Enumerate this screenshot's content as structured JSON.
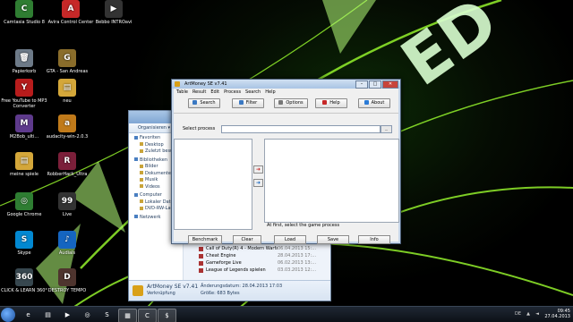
{
  "desktop_icons": [
    {
      "label": "Camtasia Studio 8",
      "glyph": "C",
      "color": "#2f7d32"
    },
    {
      "label": "Avira Control Center",
      "glyph": "A",
      "color": "#c62828"
    },
    {
      "label": "Bebbo INTROavi",
      "glyph": "▶",
      "color": "#333333"
    },
    {
      "label": "Papierkorb",
      "glyph": "🗑",
      "color": "#6d7a88"
    },
    {
      "label": "GTA - San Andreas",
      "glyph": "G",
      "color": "#8a6d2b"
    },
    {
      "label": "Free YouTube to MP3 Converter",
      "glyph": "Y",
      "color": "#b71c1c"
    },
    {
      "label": "neu",
      "glyph": "▤",
      "color": "#d4a73a"
    },
    {
      "label": "M2Bob_ulti...",
      "glyph": "M",
      "color": "#5e3a8c"
    },
    {
      "label": "audacity-win-2.0.3",
      "glyph": "a",
      "color": "#c07a1a"
    },
    {
      "label": "meine spiele",
      "glyph": "▤",
      "color": "#d4a73a"
    },
    {
      "label": "RobberHack_Ultra",
      "glyph": "R",
      "color": "#7b1f3a"
    },
    {
      "label": "Google Chrome",
      "glyph": "◎",
      "color": "#2e7d32"
    },
    {
      "label": "Live",
      "glyph": "99",
      "color": "#333333"
    },
    {
      "label": "Skype",
      "glyph": "S",
      "color": "#0288d1"
    },
    {
      "label": "Audials",
      "glyph": "♪",
      "color": "#1565c0"
    },
    {
      "label": "CLICK & LEARN 360°",
      "glyph": "360",
      "color": "#37474f"
    },
    {
      "label": "DESTROY TEMPO",
      "glyph": "D",
      "color": "#4e342e"
    }
  ],
  "explorer": {
    "toolbar_label": "Organisieren ▾",
    "nav": [
      {
        "label": "Favoriten",
        "head": true
      },
      {
        "label": "Desktop",
        "head": false
      },
      {
        "label": "Zuletzt besucht",
        "head": false
      },
      {
        "label": "Bibliotheken",
        "head": true
      },
      {
        "label": "Bilder",
        "head": false
      },
      {
        "label": "Dokumente",
        "head": false
      },
      {
        "label": "Musik",
        "head": false
      },
      {
        "label": "Videos",
        "head": false
      },
      {
        "label": "Computer",
        "head": true
      },
      {
        "label": "Lokaler Datenträger",
        "head": false
      },
      {
        "label": "DVD-RW-Laufwerk",
        "head": false
      },
      {
        "label": "Netzwerk",
        "head": true
      }
    ],
    "files": [
      {
        "name": "Call of Duty(R) 4 - Modern Warfare(TM) - Singleplayer",
        "date": "06.04.2013 15:..."
      },
      {
        "name": "Cheat Engine",
        "date": "28.04.2013 17:..."
      },
      {
        "name": "Gameforge Live",
        "date": "06.02.2013 13:..."
      },
      {
        "name": "League of Legends spielen",
        "date": "03.03.2013 12:..."
      }
    ],
    "details": {
      "name": "ArtMoney SE v7.41",
      "type": "Verknüpfung",
      "date_label": "Änderungsdatum: 28.04.2013 17:03",
      "size_label": "Größe: 683 Bytes"
    }
  },
  "artmoney": {
    "title": "ArtMoney SE v7.41",
    "menu": [
      "Table",
      "Result",
      "Edit",
      "Process",
      "Search",
      "Help"
    ],
    "buttons": {
      "search": "Search",
      "filter": "Filter",
      "options": "Options",
      "help": "Help",
      "about": "About"
    },
    "select_process_label": "Select process",
    "select_process_value": "",
    "status": "At first, select the game process",
    "bottom_buttons": {
      "benchmark": "Benchmark",
      "clear": "Clear",
      "load": "Load",
      "save": "Save",
      "info": "Info"
    }
  },
  "taskbar": {
    "items": [
      {
        "glyph": "e",
        "name": "internet-explorer-icon"
      },
      {
        "glyph": "▤",
        "name": "explorer-icon"
      },
      {
        "glyph": "▶",
        "name": "media-player-icon"
      },
      {
        "glyph": "◎",
        "name": "chrome-icon"
      },
      {
        "glyph": "S",
        "name": "skype-icon"
      },
      {
        "glyph": "▦",
        "name": "game-icon"
      },
      {
        "glyph": "C",
        "name": "camtasia-icon"
      },
      {
        "glyph": "$",
        "name": "artmoney-icon"
      }
    ],
    "language": "DE",
    "time": "09:45",
    "date": "27.04.2013"
  },
  "colors": {
    "accent_green": "#9cff2e",
    "window_frame": "#c8d7ea"
  }
}
